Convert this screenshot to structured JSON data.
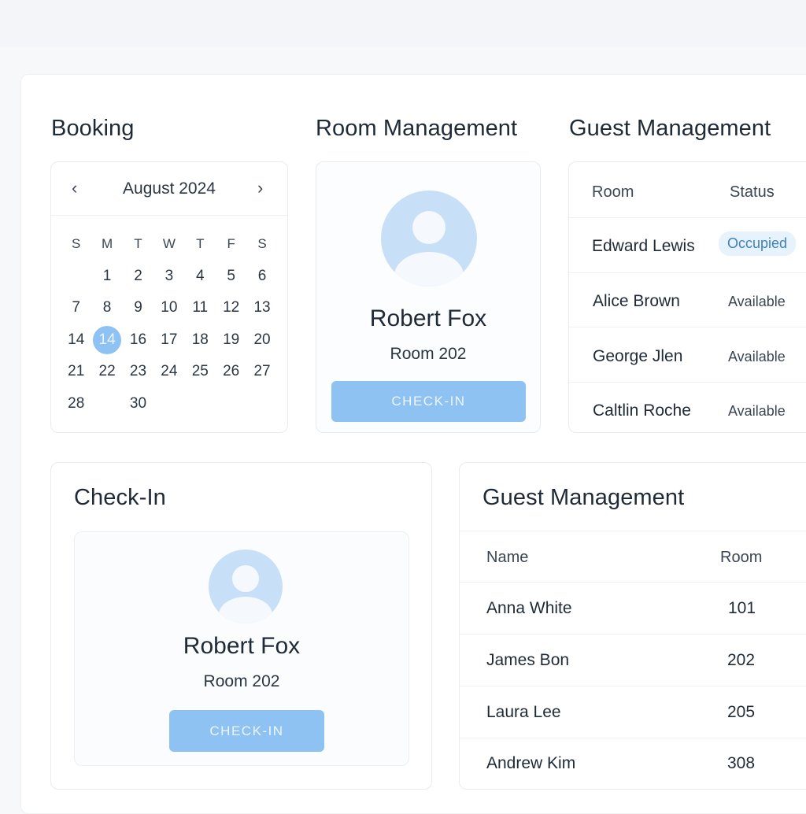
{
  "booking": {
    "title": "Booking",
    "calendar": {
      "month_label": "August 2024",
      "prev_icon": "‹",
      "next_icon": "›",
      "weekdays": [
        "S",
        "M",
        "T",
        "W",
        "T",
        "F",
        "S"
      ],
      "weeks": [
        [
          "",
          "1",
          "2",
          "3",
          "4",
          "5",
          "6"
        ],
        [
          "7",
          "8",
          "9",
          "10",
          "11",
          "12",
          "13"
        ],
        [
          "14",
          "14",
          "16",
          "17",
          "18",
          "19",
          "20"
        ],
        [
          "21",
          "22",
          "23",
          "24",
          "25",
          "26",
          "27"
        ],
        [
          "28",
          "",
          "30",
          "",
          "",
          "",
          ""
        ]
      ],
      "selected_day": "14"
    }
  },
  "room_management": {
    "title": "Room Management",
    "name": "Robert Fox",
    "room": "Room 202",
    "button_label": "CHECK-IN"
  },
  "guest_management_top": {
    "title": "Guest Management",
    "headers": [
      "Room",
      "Status"
    ],
    "rows": [
      {
        "name": "Edward Lewis",
        "status": "Occupied"
      },
      {
        "name": "Alice Brown",
        "status": "Available"
      },
      {
        "name": "George Jlen",
        "status": "Available"
      },
      {
        "name": "Caltlin Roche",
        "status": "Available"
      }
    ]
  },
  "check_in": {
    "title": "Check-In",
    "name": "Robert Fox",
    "room": "Room 202",
    "button_label": "CHECK-IN"
  },
  "guest_management_bottom": {
    "title": "Guest Management",
    "headers": [
      "Name",
      "Room"
    ],
    "rows": [
      {
        "name": "Anna White",
        "room": "101"
      },
      {
        "name": "James Bon",
        "room": "202"
      },
      {
        "name": "Laura Lee",
        "room": "205"
      },
      {
        "name": "Andrew Kim",
        "room": "308"
      }
    ]
  },
  "colors": {
    "accent": "#8ec2f3",
    "avatar": "#c8e0f7",
    "badge_bg": "#e6f2fc",
    "badge_text": "#3f7fc2"
  }
}
